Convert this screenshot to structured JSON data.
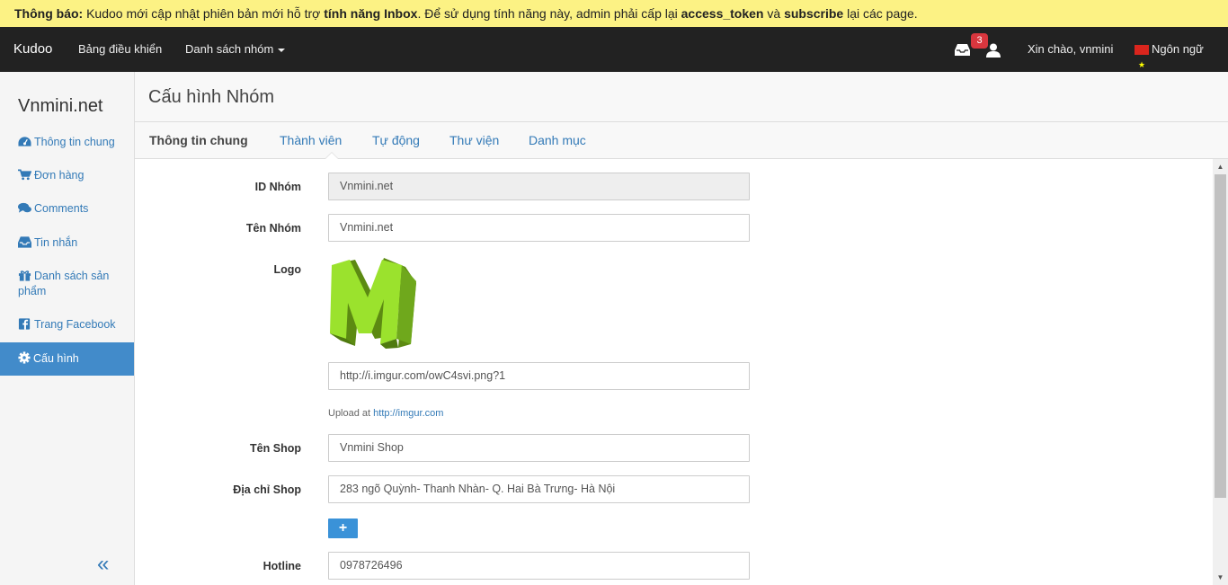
{
  "notice": {
    "prefix": "Thông báo:",
    "text1": " Kudoo mới cập nhật phiên bản mới hỗ trợ ",
    "feature": "tính năng Inbox",
    "text2": ". Để sử dụng tính năng này, admin phải cấp lại ",
    "token": "access_token",
    "text3": " và ",
    "subscribe": "subscribe",
    "text4": " lại các page."
  },
  "navbar": {
    "brand": "Kudoo",
    "dashboard": "Bảng điều khiển",
    "groups": "Danh sách nhóm",
    "inbox_count": "3",
    "greeting": "Xin chào, vnmini",
    "language": "Ngôn ngữ"
  },
  "sidebar": {
    "title": "Vnmini.net",
    "items": [
      {
        "label": "Thông tin chung",
        "icon": "dashboard-icon"
      },
      {
        "label": "Đơn hàng",
        "icon": "cart-icon"
      },
      {
        "label": "Comments",
        "icon": "comments-icon"
      },
      {
        "label": "Tin nhắn",
        "icon": "inbox-icon"
      },
      {
        "label": "Danh sách sản phẩm",
        "icon": "gift-icon"
      },
      {
        "label": "Trang Facebook",
        "icon": "facebook-icon"
      },
      {
        "label": "Cấu hình",
        "icon": "gear-icon",
        "active": true
      }
    ],
    "collapse": "«"
  },
  "page": {
    "title": "Cấu hình Nhóm",
    "tabs": [
      "Thông tin chung",
      "Thành viên",
      "Tự động",
      "Thư viện",
      "Danh mục"
    ]
  },
  "form": {
    "id_label": "ID Nhóm",
    "id_value": "Vnmini.net",
    "name_label": "Tên Nhóm",
    "name_value": "Vnmini.net",
    "logo_label": "Logo",
    "logo_url": "http://i.imgur.com/owC4svi.png?1",
    "upload_text": "Upload at ",
    "upload_link": "http://imgur.com",
    "shop_label": "Tên Shop",
    "shop_value": "Vnmini Shop",
    "address_label": "Địa chỉ Shop",
    "address_value": "283 ngõ Quỳnh- Thanh Nhàn- Q. Hai Bà Trưng- Hà Nội",
    "add_button": "+",
    "hotline_label": "Hotline",
    "hotline_value": "0978726496"
  },
  "colors": {
    "notice_bg": "#fcf284",
    "navbar_bg": "#222222",
    "accent": "#428bca",
    "badge": "#d9363e",
    "logo_green": "#9be22d"
  }
}
